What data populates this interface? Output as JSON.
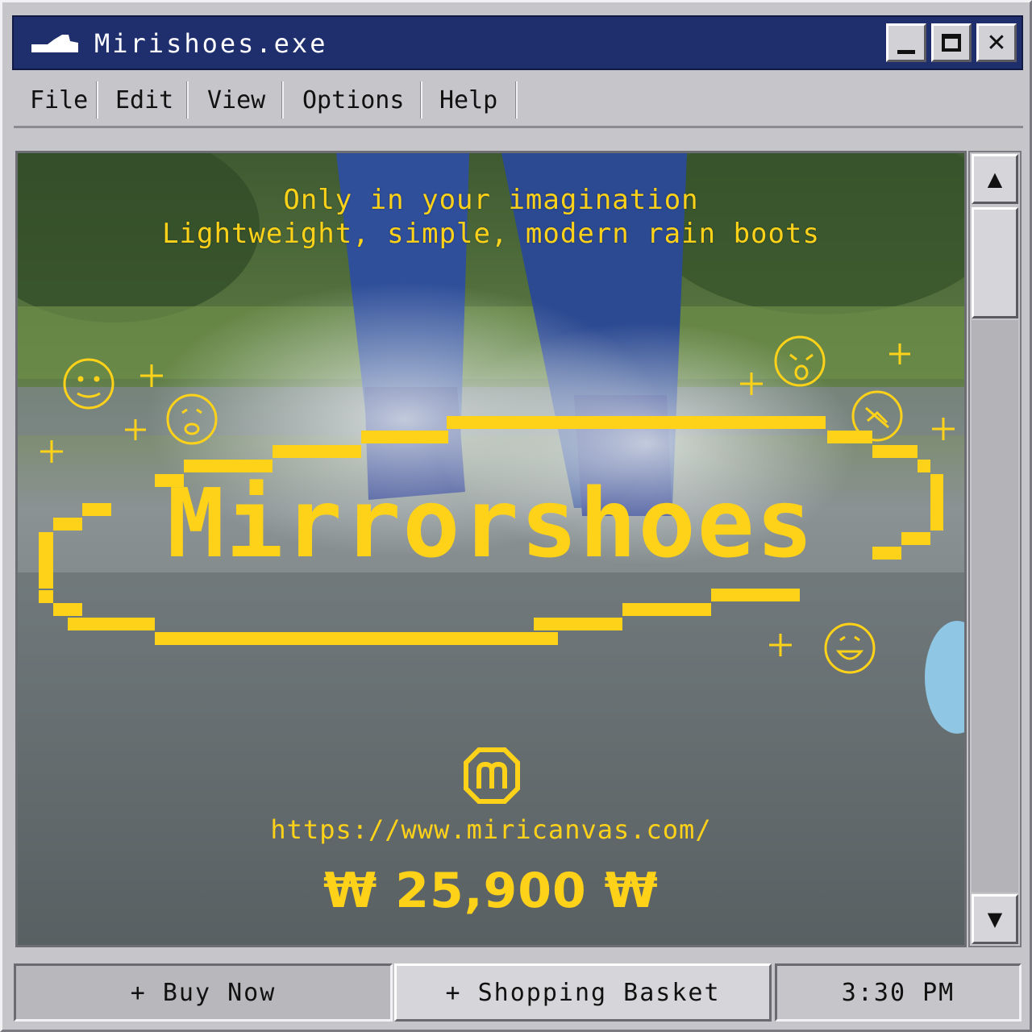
{
  "window": {
    "title": "Mirishoes.exe",
    "title_icon": "shoe-icon",
    "controls": {
      "minimize": "minimize-icon",
      "maximize": "maximize-icon",
      "close_label": "✕"
    }
  },
  "menu": {
    "items": [
      {
        "label": "File"
      },
      {
        "label": "Edit"
      },
      {
        "label": "View"
      },
      {
        "label": "Options"
      },
      {
        "label": "Help"
      }
    ]
  },
  "content": {
    "tagline_1": "Only in your imagination",
    "tagline_2": "Lightweight, simple, modern rain boots",
    "brand": "Mirrorshoes",
    "url": "https://www.miricanvas.com/",
    "price": "₩ 25,900 ₩",
    "logo_icon": "m-logo-icon",
    "decor_icons": [
      "smiley-icon",
      "sparkle-icon"
    ]
  },
  "scrollbar": {
    "up": "▲",
    "down": "▼"
  },
  "bottom": {
    "buy_now": "+ Buy Now",
    "basket": "+ Shopping Basket",
    "clock": "3:30 PM"
  },
  "colors": {
    "accent_yellow": "#ffd21a",
    "titlebar_blue": "#1f2f6e",
    "chrome_gray": "#c6c6ca"
  }
}
